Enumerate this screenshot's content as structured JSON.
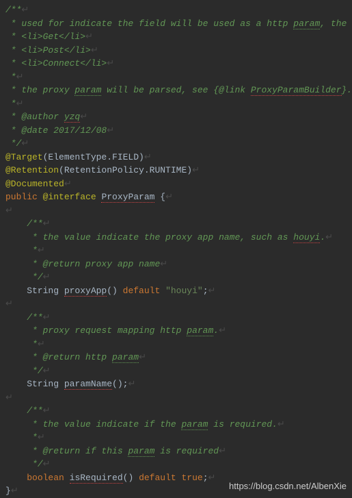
{
  "code": {
    "lines": [
      {
        "segments": [
          {
            "type": "comment-green",
            "text": "/**"
          },
          {
            "type": "whitespace-marker",
            "text": "↵"
          }
        ]
      },
      {
        "segments": [
          {
            "type": "comment-green",
            "text": " * used for indicate the field will be used as a http "
          },
          {
            "type": "comment-green typo",
            "text": "param"
          },
          {
            "type": "comment-green",
            "text": ", the http request methods include as follows:"
          },
          {
            "type": "whitespace-marker",
            "text": "↵"
          }
        ]
      },
      {
        "segments": [
          {
            "type": "comment-green",
            "text": " * <li>Get</li>"
          },
          {
            "type": "whitespace-marker",
            "text": "↵"
          }
        ]
      },
      {
        "segments": [
          {
            "type": "comment-green",
            "text": " * <li>Post</li>"
          },
          {
            "type": "whitespace-marker",
            "text": "↵"
          }
        ]
      },
      {
        "segments": [
          {
            "type": "comment-green",
            "text": " * <li>Connect</li>"
          },
          {
            "type": "whitespace-marker",
            "text": "↵"
          }
        ]
      },
      {
        "segments": [
          {
            "type": "comment-green",
            "text": " *"
          },
          {
            "type": "whitespace-marker",
            "text": "↵"
          }
        ]
      },
      {
        "segments": [
          {
            "type": "comment-green",
            "text": " * the proxy "
          },
          {
            "type": "comment-green typo",
            "text": "param"
          },
          {
            "type": "comment-green",
            "text": " will be parsed, see {@link "
          },
          {
            "type": "comment-green typo-red",
            "text": "ProxyParamBuilder"
          },
          {
            "type": "comment-green",
            "text": "}."
          },
          {
            "type": "whitespace-marker",
            "text": "↵"
          }
        ]
      },
      {
        "segments": [
          {
            "type": "comment-green",
            "text": " *"
          },
          {
            "type": "whitespace-marker",
            "text": "↵"
          }
        ]
      },
      {
        "segments": [
          {
            "type": "comment-green",
            "text": " * @author "
          },
          {
            "type": "comment-green typo-red",
            "text": "yzq"
          },
          {
            "type": "whitespace-marker",
            "text": "↵"
          }
        ]
      },
      {
        "segments": [
          {
            "type": "comment-green",
            "text": " * @date 2017/12/08"
          },
          {
            "type": "whitespace-marker",
            "text": "↵"
          }
        ]
      },
      {
        "segments": [
          {
            "type": "comment-green",
            "text": " */"
          },
          {
            "type": "whitespace-marker",
            "text": "↵"
          }
        ]
      },
      {
        "segments": [
          {
            "type": "annotation",
            "text": "@Target"
          },
          {
            "type": "identifier",
            "text": "(ElementType."
          },
          {
            "type": "identifier",
            "text": "FIELD"
          },
          {
            "type": "identifier",
            "text": ")"
          },
          {
            "type": "whitespace-marker",
            "text": "↵"
          }
        ]
      },
      {
        "segments": [
          {
            "type": "annotation",
            "text": "@Retention"
          },
          {
            "type": "identifier",
            "text": "(RetentionPolicy."
          },
          {
            "type": "identifier",
            "text": "RUNTIME"
          },
          {
            "type": "identifier",
            "text": ")"
          },
          {
            "type": "whitespace-marker",
            "text": "↵"
          }
        ]
      },
      {
        "segments": [
          {
            "type": "annotation",
            "text": "@Documented"
          },
          {
            "type": "whitespace-marker",
            "text": "↵"
          }
        ]
      },
      {
        "segments": [
          {
            "type": "keyword",
            "text": "public "
          },
          {
            "type": "annotation",
            "text": "@interface"
          },
          {
            "type": "identifier",
            "text": " "
          },
          {
            "type": "identifier typo-red",
            "text": "ProxyParam"
          },
          {
            "type": "identifier",
            "text": " {"
          },
          {
            "type": "whitespace-marker",
            "text": "↵"
          }
        ]
      },
      {
        "segments": [
          {
            "type": "whitespace-marker",
            "text": "↵"
          }
        ]
      },
      {
        "segments": [
          {
            "type": "identifier",
            "text": "    "
          },
          {
            "type": "comment-green",
            "text": "/**"
          },
          {
            "type": "whitespace-marker",
            "text": "↵"
          }
        ]
      },
      {
        "segments": [
          {
            "type": "identifier",
            "text": "    "
          },
          {
            "type": "comment-green",
            "text": " * the value indicate the proxy app name, such as "
          },
          {
            "type": "comment-green typo-red",
            "text": "houyi"
          },
          {
            "type": "comment-green",
            "text": "."
          },
          {
            "type": "whitespace-marker",
            "text": "↵"
          }
        ]
      },
      {
        "segments": [
          {
            "type": "identifier",
            "text": "    "
          },
          {
            "type": "comment-green",
            "text": " *"
          },
          {
            "type": "whitespace-marker",
            "text": "↵"
          }
        ]
      },
      {
        "segments": [
          {
            "type": "identifier",
            "text": "    "
          },
          {
            "type": "comment-green",
            "text": " * @return proxy app name"
          },
          {
            "type": "whitespace-marker",
            "text": "↵"
          }
        ]
      },
      {
        "segments": [
          {
            "type": "identifier",
            "text": "    "
          },
          {
            "type": "comment-green",
            "text": " */"
          },
          {
            "type": "whitespace-marker",
            "text": "↵"
          }
        ]
      },
      {
        "segments": [
          {
            "type": "identifier",
            "text": "    String "
          },
          {
            "type": "identifier typo-red",
            "text": "proxyApp"
          },
          {
            "type": "identifier",
            "text": "() "
          },
          {
            "type": "keyword",
            "text": "default "
          },
          {
            "type": "string",
            "text": "\"houyi\""
          },
          {
            "type": "identifier",
            "text": ";"
          },
          {
            "type": "whitespace-marker",
            "text": "↵"
          }
        ]
      },
      {
        "segments": [
          {
            "type": "whitespace-marker",
            "text": "↵"
          }
        ]
      },
      {
        "segments": [
          {
            "type": "identifier",
            "text": "    "
          },
          {
            "type": "comment-green",
            "text": "/**"
          },
          {
            "type": "whitespace-marker",
            "text": "↵"
          }
        ]
      },
      {
        "segments": [
          {
            "type": "identifier",
            "text": "    "
          },
          {
            "type": "comment-green",
            "text": " * proxy request mapping http "
          },
          {
            "type": "comment-green typo",
            "text": "param"
          },
          {
            "type": "comment-green",
            "text": "."
          },
          {
            "type": "whitespace-marker",
            "text": "↵"
          }
        ]
      },
      {
        "segments": [
          {
            "type": "identifier",
            "text": "    "
          },
          {
            "type": "comment-green",
            "text": " *"
          },
          {
            "type": "whitespace-marker",
            "text": "↵"
          }
        ]
      },
      {
        "segments": [
          {
            "type": "identifier",
            "text": "    "
          },
          {
            "type": "comment-green",
            "text": " * @return http "
          },
          {
            "type": "comment-green typo",
            "text": "param"
          },
          {
            "type": "whitespace-marker",
            "text": "↵"
          }
        ]
      },
      {
        "segments": [
          {
            "type": "identifier",
            "text": "    "
          },
          {
            "type": "comment-green",
            "text": " */"
          },
          {
            "type": "whitespace-marker",
            "text": "↵"
          }
        ]
      },
      {
        "segments": [
          {
            "type": "identifier",
            "text": "    String "
          },
          {
            "type": "identifier typo-red",
            "text": "paramName"
          },
          {
            "type": "identifier",
            "text": "();"
          },
          {
            "type": "whitespace-marker",
            "text": "↵"
          }
        ]
      },
      {
        "segments": [
          {
            "type": "whitespace-marker",
            "text": "↵"
          }
        ]
      },
      {
        "segments": [
          {
            "type": "identifier",
            "text": "    "
          },
          {
            "type": "comment-green",
            "text": "/**"
          },
          {
            "type": "whitespace-marker",
            "text": "↵"
          }
        ]
      },
      {
        "segments": [
          {
            "type": "identifier",
            "text": "    "
          },
          {
            "type": "comment-green",
            "text": " * the value indicate if the "
          },
          {
            "type": "comment-green typo",
            "text": "param"
          },
          {
            "type": "comment-green",
            "text": " is required."
          },
          {
            "type": "whitespace-marker",
            "text": "↵"
          }
        ]
      },
      {
        "segments": [
          {
            "type": "identifier",
            "text": "    "
          },
          {
            "type": "comment-green",
            "text": " *"
          },
          {
            "type": "whitespace-marker",
            "text": "↵"
          }
        ]
      },
      {
        "segments": [
          {
            "type": "identifier",
            "text": "    "
          },
          {
            "type": "comment-green",
            "text": " * @return if this "
          },
          {
            "type": "comment-green typo",
            "text": "param"
          },
          {
            "type": "comment-green",
            "text": " is required"
          },
          {
            "type": "whitespace-marker",
            "text": "↵"
          }
        ]
      },
      {
        "segments": [
          {
            "type": "identifier",
            "text": "    "
          },
          {
            "type": "comment-green",
            "text": " */"
          },
          {
            "type": "whitespace-marker",
            "text": "↵"
          }
        ]
      },
      {
        "segments": [
          {
            "type": "identifier",
            "text": "    "
          },
          {
            "type": "keyword",
            "text": "boolean "
          },
          {
            "type": "identifier typo-red",
            "text": "isRequired"
          },
          {
            "type": "identifier",
            "text": "() "
          },
          {
            "type": "keyword",
            "text": "default true"
          },
          {
            "type": "identifier",
            "text": ";"
          },
          {
            "type": "whitespace-marker",
            "text": "↵"
          }
        ]
      },
      {
        "segments": [
          {
            "type": "identifier",
            "text": "}"
          },
          {
            "type": "whitespace-marker",
            "text": "↵"
          }
        ]
      }
    ]
  },
  "watermark": "https://blog.csdn.net/AlbenXie"
}
